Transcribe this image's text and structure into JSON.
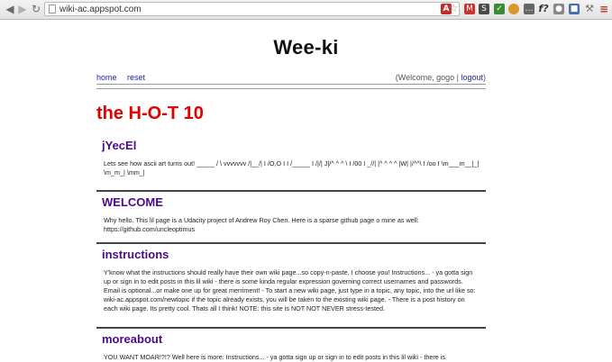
{
  "browser": {
    "url": "wiki-ac.appspot.com",
    "icons": [
      "back-icon",
      "forward-icon",
      "reload-icon",
      "page-icon",
      "pdf-icon",
      "star-icon",
      "gmail-icon",
      "shield-icon",
      "check-icon",
      "cookie-icon",
      "chat-icon",
      "fx-icon",
      "camera-icon",
      "box-icon",
      "wrench-icon",
      "menu-icon"
    ]
  },
  "site": {
    "title": "Wee-ki",
    "nav": {
      "home": "home",
      "reset": "reset"
    },
    "welcome_prefix": "(Welcome, gogo | ",
    "logout": "logout",
    "welcome_suffix": ")",
    "hot_title": "the H-O-T 10"
  },
  "posts": [
    {
      "title": "jYecEl",
      "body": "Lets see how ascii art turns out! _____ / \\ vvvvvvv /|__/| I /O,O I I /_____ I /|/| J|/^ ^ ^ \\ I /00 I _//| |^ ^ ^ ^ |W| |/^^\\ I /oo I \\m___m__|_| \\m_m_| \\mm_|"
    },
    {
      "title": "WELCOME",
      "body": "Why hello. This lil page is a Udacity project of Andrew Roy Chen. Here is a sparse github page o mine as well: https://github.com/uncleoptimus"
    },
    {
      "title": "instructions",
      "body": "Y'know what the instructions should really have their own wiki page...so copy-n-paste, I choose you! Instructions... - ya gotta sign up or sign in to edit posts in this lil wiki - there is some kinda regular expression governing correct usernames and passwords. Email is optional...or make one up for great merriment! - To start a new wiki page, just type in a topic, any topic, into the url like so: wiki-ac.appspot.com/newtopic if the topic already exists, you will be taken to the existing wiki page. - There is a post history on each wiki page. Its pretty cool. Thats all I think! NOTE: this site is NOT NOT NEVER stress-tested."
    },
    {
      "title": "moreabout",
      "body": "YOU WANT MOAR!?!? Well here is more: Instructions... - ya gotta sign up or sign in to edit posts in this lil wiki - there is"
    }
  ]
}
